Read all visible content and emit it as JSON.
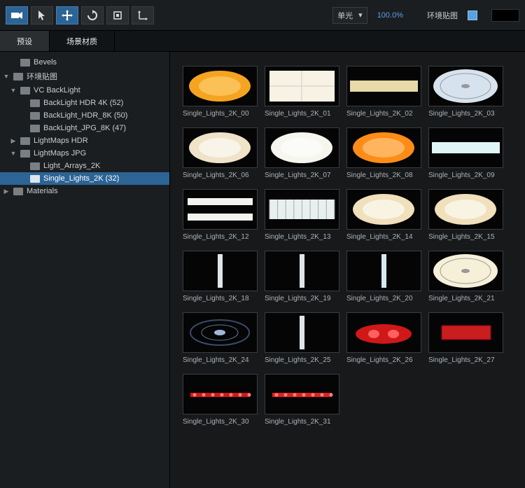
{
  "toolbar": {
    "dropdown_label": "单光",
    "zoom": "100.0%",
    "env_label": "环境贴图"
  },
  "tabs": {
    "preset": "预设",
    "scene_material": "场景材质"
  },
  "tree": [
    {
      "indent": 1,
      "arrow": "",
      "label": "Bevels"
    },
    {
      "indent": 0,
      "arrow": "▼",
      "label": "环境贴图"
    },
    {
      "indent": 1,
      "arrow": "▼",
      "label": "VC BackLight"
    },
    {
      "indent": 2,
      "arrow": "",
      "label": "BackLight HDR 4K (52)"
    },
    {
      "indent": 2,
      "arrow": "",
      "label": "BackLight_HDR_8K (50)"
    },
    {
      "indent": 2,
      "arrow": "",
      "label": "BackLight_JPG_8K (47)"
    },
    {
      "indent": 1,
      "arrow": "▶",
      "label": "LightMaps HDR"
    },
    {
      "indent": 1,
      "arrow": "▼",
      "label": "LightMaps JPG"
    },
    {
      "indent": 2,
      "arrow": "",
      "label": "Light_Arrays_2K"
    },
    {
      "indent": 2,
      "arrow": "",
      "label": "Single_Lights_2K (32)",
      "selected": true
    },
    {
      "indent": 0,
      "arrow": "▶",
      "label": "Materials"
    }
  ],
  "thumbs": [
    {
      "label": "Single_Lights_2K_00",
      "kind": "ellipse",
      "fill": "#f5a421",
      "glow": "#ffd37a"
    },
    {
      "label": "Single_Lights_2K_01",
      "kind": "panel",
      "fill": "#f8f2e4"
    },
    {
      "label": "Single_Lights_2K_02",
      "kind": "strip",
      "fill": "#e8d9a8"
    },
    {
      "label": "Single_Lights_2K_03",
      "kind": "ring",
      "fill": "#d6e3ee"
    },
    {
      "label": "Single_Lights_2K_06",
      "kind": "ellipse",
      "fill": "#efe3c8",
      "glow": "#fff"
    },
    {
      "label": "Single_Lights_2K_07",
      "kind": "ellipse",
      "fill": "#f6f5ee",
      "glow": "#fff"
    },
    {
      "label": "Single_Lights_2K_08",
      "kind": "ellipse",
      "fill": "#ff8c17",
      "glow": "#ffd090"
    },
    {
      "label": "Single_Lights_2K_09",
      "kind": "strip",
      "fill": "#dff6f6"
    },
    {
      "label": "Single_Lights_2K_12",
      "kind": "bars",
      "fill": "#f3f3ef"
    },
    {
      "label": "Single_Lights_2K_13",
      "kind": "grid",
      "fill": "#e8efef"
    },
    {
      "label": "Single_Lights_2K_14",
      "kind": "ellipse",
      "fill": "#f0e0bb",
      "glow": "#fff"
    },
    {
      "label": "Single_Lights_2K_15",
      "kind": "ellipse",
      "fill": "#f0e0bb",
      "glow": "#fff"
    },
    {
      "label": "Single_Lights_2K_18",
      "kind": "tube",
      "fill": "#e0e4e6"
    },
    {
      "label": "Single_Lights_2K_19",
      "kind": "tube",
      "fill": "#e0e4e6"
    },
    {
      "label": "Single_Lights_2K_20",
      "kind": "tube",
      "fill": "#d8e8ee"
    },
    {
      "label": "Single_Lights_2K_21",
      "kind": "ring",
      "fill": "#f6f0d8"
    },
    {
      "label": "Single_Lights_2K_24",
      "kind": "lens",
      "fill": "#9fb8e0"
    },
    {
      "label": "Single_Lights_2K_25",
      "kind": "tube",
      "fill": "#e0e4e6"
    },
    {
      "label": "Single_Lights_2K_26",
      "kind": "redcar",
      "fill": "#d01818"
    },
    {
      "label": "Single_Lights_2K_27",
      "kind": "redbar",
      "fill": "#e02020"
    },
    {
      "label": "Single_Lights_2K_30",
      "kind": "redstrip",
      "fill": "#d01818"
    },
    {
      "label": "Single_Lights_2K_31",
      "kind": "redstrip",
      "fill": "#e02020"
    }
  ],
  "icons": {
    "camera": "camera",
    "pointer": "pointer",
    "move": "move",
    "rotate": "rotate",
    "crop": "crop",
    "axis": "axis"
  }
}
